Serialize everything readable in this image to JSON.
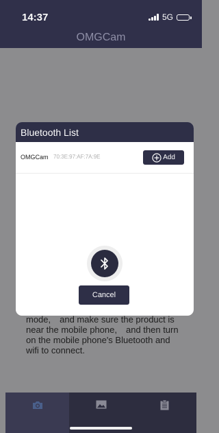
{
  "status_bar": {
    "time": "14:37",
    "network": "5G"
  },
  "nav": {
    "title": "OMGCam"
  },
  "background_text": "mode,　and make sure the product is near the mobile phone,　and then turn on the mobile phone's Bluetooth and wifi to connect.",
  "dialog": {
    "title": "Bluetooth List",
    "devices": [
      {
        "name": "OMGCam",
        "mac": "70:3E:97:AF:7A:9E",
        "add_label": "Add"
      }
    ],
    "cancel_label": "Cancel"
  },
  "tabs": [
    {
      "icon": "camera-icon",
      "active": true
    },
    {
      "icon": "image-icon",
      "active": false
    },
    {
      "icon": "clipboard-icon",
      "active": false
    }
  ],
  "colors": {
    "header": "#30304a",
    "accent": "#2e2f47",
    "overlay": "#8c8c8e"
  }
}
